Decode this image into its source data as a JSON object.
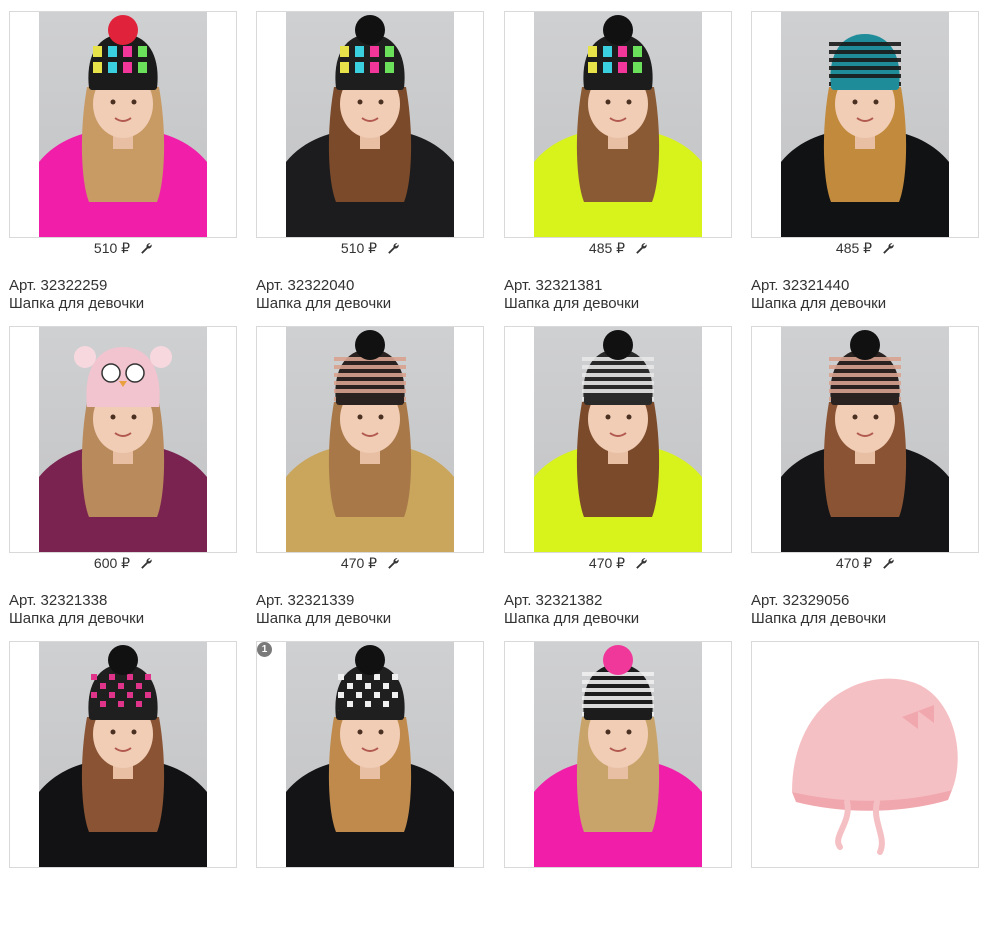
{
  "products": [
    {
      "price": "510 ₽",
      "art": "Арт. 32322259",
      "name": "Шапка для девочки",
      "badge": "",
      "hat": "#1b1b1b",
      "hat2": "#e7e24a",
      "pom": "#e0233a",
      "jacket": "#f01ea9",
      "hair": "#c89a64",
      "bg": "#cfcfd1",
      "style": "letters"
    },
    {
      "price": "510 ₽",
      "art": "Арт. 32322040",
      "name": "Шапка для девочки",
      "badge": "",
      "hat": "#1e1e1e",
      "hat2": "#f2369a",
      "pom": "#111111",
      "jacket": "#1c1c1e",
      "hair": "#7b4a2a",
      "bg": "#cfcfd1",
      "style": "letters"
    },
    {
      "price": "485 ₽",
      "art": "Арт. 32321381",
      "name": "Шапка для девочки",
      "badge": "",
      "hat": "#1c1c1c",
      "hat2": "#d43dd0",
      "pom": "#111111",
      "jacket": "#d8f21c",
      "hair": "#8a5a34",
      "bg": "#cfcfd1",
      "style": "letters"
    },
    {
      "price": "485 ₽",
      "art": "Арт. 32321440",
      "name": "Шапка для девочки",
      "badge": "",
      "hat": "#1f8c9a",
      "hat2": "#1a1a1a",
      "pom": "",
      "jacket": "#111214",
      "hair": "#c28a3c",
      "bg": "#cfcfd1",
      "style": "stripes"
    },
    {
      "price": "600 ₽",
      "art": "Арт. 32321338",
      "name": "Шапка для девочки",
      "badge": "",
      "hat": "#f2c4cf",
      "hat2": "#f7d8df",
      "pom": "",
      "jacket": "#7a2350",
      "hair": "#b98a5c",
      "bg": "#cfcfd1",
      "style": "owl"
    },
    {
      "price": "470 ₽",
      "art": "Арт. 32321339",
      "name": "Шапка для девочки",
      "badge": "",
      "hat": "#2a2220",
      "hat2": "#d8a28e",
      "pom": "#111111",
      "jacket": "#c9a65c",
      "hair": "#a87848",
      "bg": "#cfcfd1",
      "style": "stripes"
    },
    {
      "price": "470 ₽",
      "art": "Арт. 32321382",
      "name": "Шапка для девочки",
      "badge": "",
      "hat": "#2a2a2a",
      "hat2": "#e8e8e8",
      "pom": "#111111",
      "jacket": "#d8f21c",
      "hair": "#7a4a2a",
      "bg": "#cfcfd1",
      "style": "stripes"
    },
    {
      "price": "470 ₽",
      "art": "Арт. 32329056",
      "name": "Шапка для девочки",
      "badge": "",
      "hat": "#2a2220",
      "hat2": "#d8a28e",
      "pom": "#111111",
      "jacket": "#151517",
      "hair": "#8a5434",
      "bg": "#cfcfd1",
      "style": "stripes"
    },
    {
      "price": "",
      "art": "",
      "name": "",
      "badge": "",
      "hat": "#1f1f1f",
      "hat2": "#e0338a",
      "pom": "#111111",
      "jacket": "#121214",
      "hair": "#8a5434",
      "bg": "#cfcfd1",
      "style": "check"
    },
    {
      "price": "",
      "art": "",
      "name": "",
      "badge": "1",
      "hat": "#1f1f1f",
      "hat2": "#f0f0f0",
      "pom": "#111111",
      "jacket": "#141416",
      "hair": "#c08a4c",
      "bg": "#cfcfd1",
      "style": "check"
    },
    {
      "price": "",
      "art": "",
      "name": "",
      "badge": "",
      "hat": "#1c1c1c",
      "hat2": "#f0f0f0",
      "pom": "#f0389a",
      "jacket": "#f01ea9",
      "hair": "#c8a46a",
      "bg": "#cfcfd1",
      "style": "stripes"
    },
    {
      "price": "",
      "art": "",
      "name": "",
      "badge": "",
      "hat": "#f5c0c4",
      "hat2": "#f0a8ae",
      "pom": "",
      "jacket": "",
      "hair": "",
      "bg": "#ffffff",
      "style": "cap"
    }
  ],
  "icons": {
    "wrench": "wrench-icon"
  }
}
